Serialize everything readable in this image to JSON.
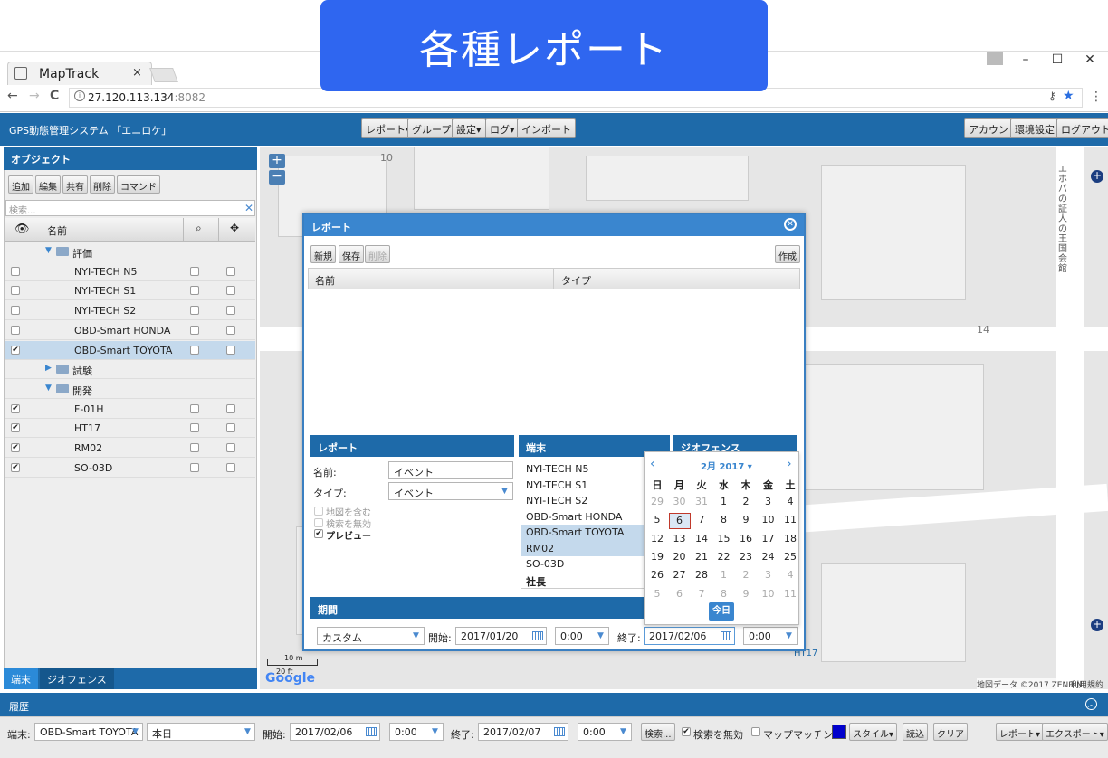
{
  "banner": {
    "text": "各種レポート"
  },
  "browser": {
    "tab_title": "MapTrack",
    "tab_close": "×",
    "url_host": "27.120.113.134",
    "url_port": ":8082",
    "win_minimize": "–",
    "win_maximize": "☐",
    "win_close": "✕",
    "nav_back": "←",
    "nav_forward": "→",
    "nav_reload": "C"
  },
  "app": {
    "title": "GPS動態管理システム 「エニロケ」",
    "menu": [
      "レポート▾",
      "グループ",
      "設定▾",
      "ログ▾",
      "インポート"
    ],
    "right_menu": [
      "アカウント",
      "環境設定",
      "ログアウト"
    ]
  },
  "objects": {
    "header": "オブジェクト",
    "buttons": [
      "追加",
      "編集",
      "共有",
      "削除",
      "コマンド"
    ],
    "search_placeholder": "検索...",
    "search_clear": "✕",
    "col_name": "名前",
    "tree": [
      {
        "type": "folder",
        "label": "評価",
        "expanded": true
      },
      {
        "type": "item",
        "label": "NYI-TECH N5",
        "checked": false
      },
      {
        "type": "item",
        "label": "NYI-TECH S1",
        "checked": false
      },
      {
        "type": "item",
        "label": "NYI-TECH S2",
        "checked": false
      },
      {
        "type": "item",
        "label": "OBD-Smart HONDA",
        "checked": false
      },
      {
        "type": "item",
        "label": "OBD-Smart TOYOTA",
        "checked": true,
        "selected": true
      },
      {
        "type": "folder",
        "label": "試験",
        "expanded": false
      },
      {
        "type": "folder",
        "label": "開発",
        "expanded": true
      },
      {
        "type": "item",
        "label": "F-01H",
        "checked": true
      },
      {
        "type": "item",
        "label": "HT17",
        "checked": true
      },
      {
        "type": "item",
        "label": "RM02",
        "checked": true
      },
      {
        "type": "item",
        "label": "SO-03D",
        "checked": true
      }
    ],
    "tabs": [
      "端末",
      "ジオフェンス"
    ]
  },
  "map": {
    "zoom_in": "+",
    "zoom_out": "−",
    "label_10": "10",
    "label_14": "14",
    "street": "エホバの証人の王国会館",
    "scale_m": "10 m",
    "scale_ft": "20 ft",
    "google": "Google",
    "copyright": "地図データ ©2017 ZENRIN",
    "terms": "利用規約",
    "marker_label": "HT17"
  },
  "report_dialog": {
    "title": "レポート",
    "close": "✕",
    "buttons": {
      "new": "新規",
      "save": "保存",
      "delete": "削除",
      "create": "作成"
    },
    "table_cols": [
      "名前",
      "タイプ"
    ],
    "report_section": {
      "header": "レポート",
      "name_label": "名前:",
      "name_value": "イベント",
      "type_label": "タイプ:",
      "type_value": "イベント",
      "opt_map": "地図を含む",
      "opt_search": "検索を無効",
      "opt_preview": "プレビュー"
    },
    "device_section": {
      "header": "端末",
      "items": [
        {
          "label": "NYI-TECH N5",
          "selected": false
        },
        {
          "label": "NYI-TECH S1",
          "selected": false
        },
        {
          "label": "NYI-TECH S2",
          "selected": false
        },
        {
          "label": "OBD-Smart HONDA",
          "selected": false
        },
        {
          "label": "OBD-Smart TOYOTA",
          "selected": true
        },
        {
          "label": "RM02",
          "selected": true
        },
        {
          "label": "SO-03D",
          "selected": false
        },
        {
          "label": "社長",
          "selected": false
        }
      ]
    },
    "geofence_section": {
      "header": "ジオフェンス"
    },
    "period": {
      "header": "期間",
      "mode": "カスタム",
      "start_label": "開始:",
      "start_date": "2017/01/20",
      "start_time": "0:00",
      "end_label": "終了:",
      "end_date": "2017/02/06",
      "end_time": "0:00"
    }
  },
  "calendar": {
    "prev": "‹",
    "next": "›",
    "month_label": "2月 2017",
    "weekdays": [
      "日",
      "月",
      "火",
      "水",
      "木",
      "金",
      "土"
    ],
    "weeks": [
      [
        "29",
        "30",
        "31",
        "1",
        "2",
        "3",
        "4"
      ],
      [
        "5",
        "6",
        "7",
        "8",
        "9",
        "10",
        "11"
      ],
      [
        "12",
        "13",
        "14",
        "15",
        "16",
        "17",
        "18"
      ],
      [
        "19",
        "20",
        "21",
        "22",
        "23",
        "24",
        "25"
      ],
      [
        "26",
        "27",
        "28",
        "1",
        "2",
        "3",
        "4"
      ],
      [
        "5",
        "6",
        "7",
        "8",
        "9",
        "10",
        "11"
      ]
    ],
    "today_button": "今日"
  },
  "history": {
    "header": "履歴",
    "device_label": "端末:",
    "device_value": "OBD-Smart TOYOTA",
    "period_value": "本日",
    "start_label": "開始:",
    "start_date": "2017/02/06",
    "start_time": "0:00",
    "end_label": "終了:",
    "end_date": "2017/02/07",
    "end_time": "0:00",
    "search_btn": "検索...",
    "disable_search": "検索を無効",
    "map_matching": "マップマッチング",
    "style_btn": "スタイル▾",
    "load_btn": "読込",
    "clear_btn": "クリア",
    "report_btn": "レポート▾",
    "export_btn": "エクスポート▾",
    "color_swatch": "#0000cc"
  }
}
